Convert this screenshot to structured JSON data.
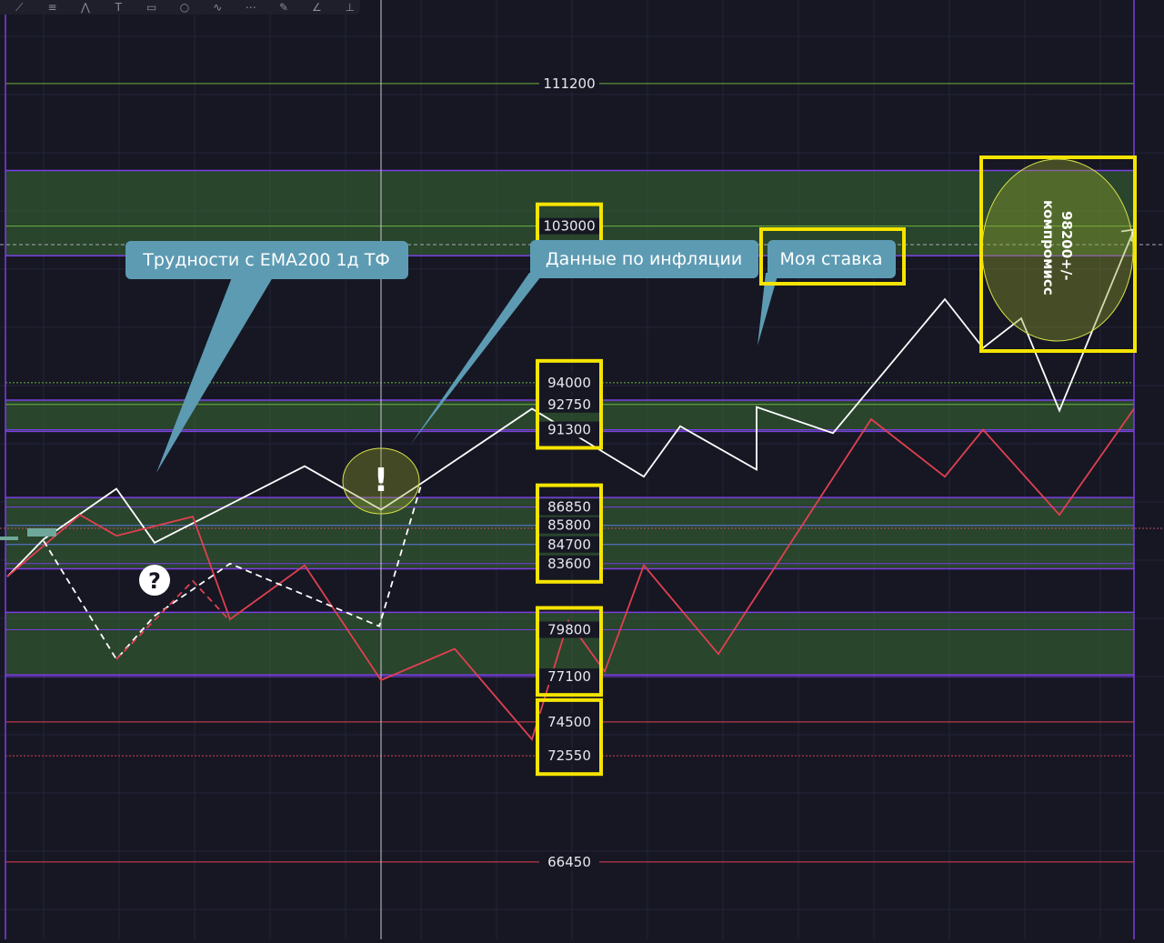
{
  "toolbar": {
    "tools": [
      {
        "name": "trendline-tool-icon",
        "glyph": "⟋"
      },
      {
        "name": "fib-tool-icon",
        "glyph": "≡"
      },
      {
        "name": "pattern-tool-icon",
        "glyph": "⋀"
      },
      {
        "name": "text-tool-icon",
        "glyph": "T"
      },
      {
        "name": "callout-tool-icon",
        "glyph": "▭"
      },
      {
        "name": "circle-tool-icon",
        "glyph": "○"
      },
      {
        "name": "curve-tool-icon",
        "glyph": "∿"
      },
      {
        "name": "path-tool-icon",
        "glyph": "⋯"
      },
      {
        "name": "brush-tool-icon",
        "glyph": "✎"
      },
      {
        "name": "gann-tool-icon",
        "glyph": "∠"
      },
      {
        "name": "measure-tool-icon",
        "glyph": "⊥"
      }
    ]
  },
  "chart_data": {
    "type": "line",
    "ylim": [
      62000,
      116000
    ],
    "xlim": [
      0,
      1280
    ],
    "levels": [
      {
        "price": 111200,
        "label": "111200",
        "color": "#6db33f",
        "style": "solid",
        "boxed": false
      },
      {
        "price": 103000,
        "label": "103000",
        "color": "#6db33f",
        "style": "solid",
        "boxed": true
      },
      {
        "price": 94000,
        "label": "94000",
        "color": "#6db33f",
        "style": "dotted",
        "boxed": false
      },
      {
        "price": 92750,
        "label": "92750",
        "color": "#6db33f",
        "style": "solid",
        "boxed": false
      },
      {
        "price": 91300,
        "label": "91300",
        "color": "#7b3fe4",
        "style": "solid",
        "boxed": false
      },
      {
        "price": 86850,
        "label": "86850",
        "color": "#7b3fe4",
        "style": "solid",
        "boxed": false
      },
      {
        "price": 85800,
        "label": "85800",
        "color": "#5b7be0",
        "style": "solid",
        "boxed": false
      },
      {
        "price": 84700,
        "label": "84700",
        "color": "#5b7be0",
        "style": "solid",
        "boxed": false
      },
      {
        "price": 83600,
        "label": "83600",
        "color": "#7b3fe4",
        "style": "solid",
        "boxed": false
      },
      {
        "price": 79800,
        "label": "79800",
        "color": "#7b3fe4",
        "style": "solid",
        "boxed": false
      },
      {
        "price": 77100,
        "label": "77100",
        "color": "#7b3fe4",
        "style": "solid",
        "boxed": false
      },
      {
        "price": 74500,
        "label": "74500",
        "color": "#e04050",
        "style": "solid",
        "boxed": false
      },
      {
        "price": 72550,
        "label": "72550",
        "color": "#e04050",
        "style": "dotted",
        "boxed": false
      },
      {
        "price": 66450,
        "label": "66450",
        "color": "#e04050",
        "style": "solid",
        "boxed": false
      }
    ],
    "zones": [
      {
        "from": 101300,
        "to": 106200,
        "color": "#3a6b35"
      },
      {
        "from": 91200,
        "to": 93000,
        "color": "#3a6b35"
      },
      {
        "from": 83300,
        "to": 87400,
        "color": "#3a6b35"
      },
      {
        "from": 77200,
        "to": 80800,
        "color": "#3a6b35"
      }
    ],
    "label_boxes": [
      {
        "top": 103000,
        "bottom": 103000,
        "color": "#f5e400"
      },
      {
        "top": 94000,
        "bottom": 91300,
        "color": "#f5e400"
      },
      {
        "top": 86850,
        "bottom": 83600,
        "color": "#f5e400"
      },
      {
        "top": 79800,
        "bottom": 77100,
        "color": "#f5e400"
      },
      {
        "top": 74500,
        "bottom": 72550,
        "color": "#f5e400"
      }
    ],
    "series": [
      {
        "color": "#ffffff",
        "style": "solid",
        "points": [
          [
            8,
            82850
          ],
          [
            48,
            85000
          ],
          [
            128,
            87900
          ],
          [
            170,
            84800
          ],
          [
            335,
            89200
          ],
          [
            419,
            86700
          ],
          [
            460,
            88100
          ],
          [
            585,
            92500
          ],
          [
            708,
            88600
          ],
          [
            748,
            91500
          ],
          [
            832,
            89000
          ],
          [
            832,
            92600
          ],
          [
            916,
            91100
          ],
          [
            1039,
            98800
          ],
          [
            1081,
            96000
          ],
          [
            1123,
            97700
          ],
          [
            1165,
            92400
          ],
          [
            1247,
            102800
          ]
        ]
      },
      {
        "color": "#e04050",
        "style": "solid",
        "points": [
          [
            8,
            82850
          ],
          [
            88,
            86400
          ],
          [
            128,
            85200
          ],
          [
            212,
            86300
          ],
          [
            253,
            80400
          ],
          [
            335,
            83500
          ],
          [
            419,
            76900
          ],
          [
            500,
            78700
          ],
          [
            585,
            73500
          ],
          [
            625,
            80300
          ],
          [
            665,
            77400
          ],
          [
            708,
            83500
          ],
          [
            790,
            78400
          ],
          [
            958,
            91900
          ],
          [
            1039,
            88600
          ],
          [
            1081,
            91300
          ],
          [
            1165,
            86400
          ],
          [
            1247,
            92500
          ]
        ]
      },
      {
        "color": "#ffffff",
        "style": "dashed",
        "points": [
          [
            48,
            84900
          ],
          [
            128,
            78100
          ],
          [
            170,
            80600
          ],
          [
            253,
            83600
          ],
          [
            417,
            80000
          ],
          [
            463,
            88100
          ]
        ]
      },
      {
        "color": "#e04050",
        "style": "dashed",
        "points": [
          [
            128,
            78100
          ],
          [
            212,
            82600
          ],
          [
            253,
            80300
          ]
        ]
      }
    ],
    "annotations": [
      {
        "type": "callout",
        "text": "Трудности с ЕМА200 1д ТФ",
        "yellow_box": false
      },
      {
        "type": "callout",
        "text": "Данные по инфляции",
        "yellow_box": false
      },
      {
        "type": "callout",
        "text": "Моя ставка",
        "yellow_box": true
      },
      {
        "type": "rotated_text",
        "text": "98200+/-",
        "text2": "компромисс"
      },
      {
        "type": "badge",
        "text": "!"
      },
      {
        "type": "badge",
        "text": "?"
      }
    ]
  }
}
